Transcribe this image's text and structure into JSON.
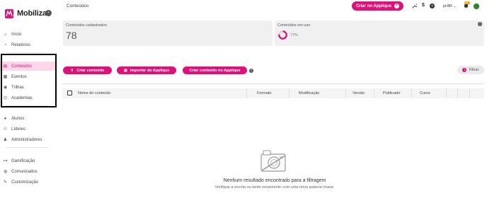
{
  "app": {
    "name": "Mobiliza",
    "brand_color": "#e0107a"
  },
  "sidebar": {
    "collapse_icon": "chevron-left-icon",
    "groups": [
      {
        "items": [
          {
            "label": "Início",
            "icon": "home-icon"
          },
          {
            "label": "Relatórios",
            "icon": "chart-pie-icon"
          }
        ]
      },
      {
        "items": [
          {
            "label": "Conteúdos",
            "icon": "content-book-icon",
            "active": true
          },
          {
            "label": "Eventos",
            "icon": "calendar-icon"
          },
          {
            "label": "Trilhas",
            "icon": "trail-icon"
          },
          {
            "label": "Academias",
            "icon": "academy-icon"
          }
        ]
      },
      {
        "items": [
          {
            "label": "Alunos",
            "icon": "user-icon"
          },
          {
            "label": "Líderes",
            "icon": "users-icon"
          },
          {
            "label": "Administradores",
            "icon": "admin-icon"
          }
        ]
      },
      {
        "items": [
          {
            "label": "Gamificação",
            "icon": "gamepad-icon"
          },
          {
            "label": "Comunicados",
            "icon": "chat-icon"
          },
          {
            "label": "Customização",
            "icon": "brush-icon"
          }
        ]
      }
    ]
  },
  "topbar": {
    "breadcrumb": "Conteúdos",
    "create_button": "Criar no Applique",
    "lang": "pt-BR",
    "notification_count": "99+"
  },
  "stats": {
    "registered_label": "Conteúdos cadastrados",
    "registered_value": "78",
    "in_use_label": "Conteúdos em uso",
    "in_use_percent": "77%",
    "in_use_fraction": 0.77
  },
  "actions": {
    "create": "Criar conteúdo",
    "import": "Importar do Applique",
    "create_applique": "Criar conteúdo no Applique",
    "filter": "Filtrar",
    "filter_count": "1"
  },
  "table": {
    "columns": [
      "Nome do conteúdo",
      "Formato",
      "Modificação",
      "Versão",
      "Publicado",
      "Curso"
    ]
  },
  "empty": {
    "title": "Nenhum resultado encontrado para a filtragem",
    "subtitle": "Verifique a escrita ou tente novamente com uma nova palavra-chave."
  }
}
